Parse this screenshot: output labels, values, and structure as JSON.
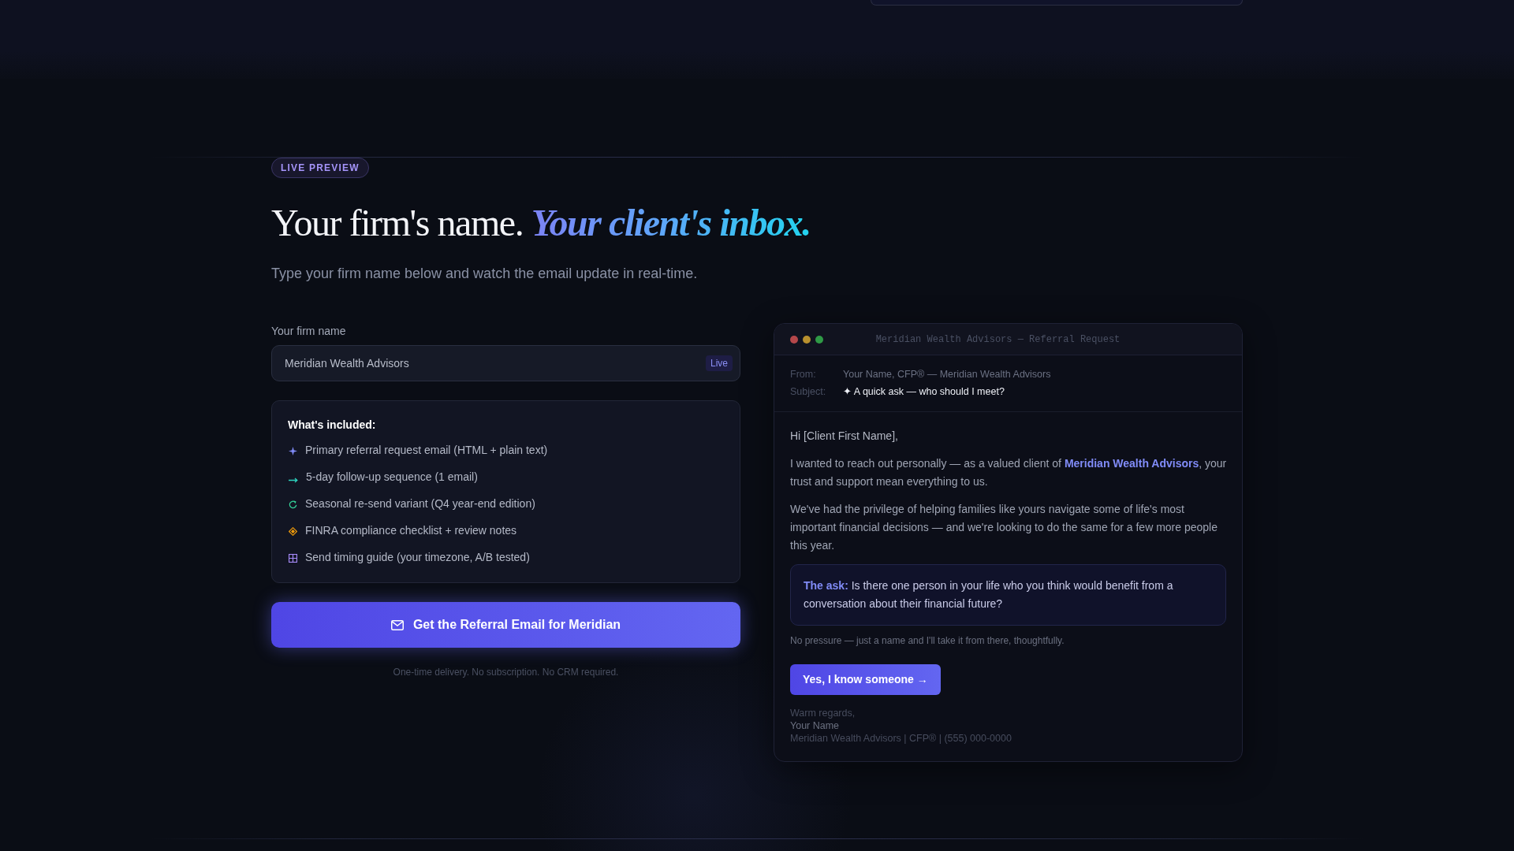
{
  "section": {
    "label": "LIVE PREVIEW",
    "heading": "Your firm's name. *Your client's inbox.*",
    "subtitle": "Type your firm name below and watch the email update in real-time."
  },
  "form": {
    "label": "Your firm name",
    "input": {
      "value": "Meridian Wealth Advisors",
      "tag": "Live"
    }
  },
  "included": {
    "title": "What's included:",
    "items": [
      {
        "kind": "sparkle",
        "text": "Primary referral request email (HTML + plain text)"
      },
      {
        "kind": "arrow",
        "text": "5-day follow-up sequence (1 email)"
      },
      {
        "kind": "refresh",
        "text": "Seasonal re-send variant (Q4 year-end edition)"
      },
      {
        "kind": "diamond",
        "text": "FINRA compliance checklist + review notes"
      },
      {
        "kind": "grid",
        "text": "Send timing guide (your timezone, A/B tested)"
      }
    ]
  },
  "cta": {
    "label": "Get the Referral Email for Meridian",
    "note": "One-time delivery. No subscription. No CRM required."
  },
  "email_preview": {
    "window_title": "Meridian Wealth Advisors — Referral Request",
    "fields": [
      {
        "kind": "sender",
        "label": "From:",
        "value": "Your Name, CFP® — Meridian Wealth Advisors"
      },
      {
        "kind": "subject",
        "label": "Subject:",
        "value": "✦ A quick ask — who should I meet?"
      }
    ],
    "greeting": "Hi [Client First Name],",
    "paragraphs": [
      "I wanted to reach out personally — as a valued client of **Meridian Wealth Advisors**, your trust and support mean everything to us.",
      "We've had the privilege of helping families like yours navigate some of life's most important financial decisions — and we're looking to do the same for a few more people this year."
    ],
    "ask": "**The ask:** Is there one person in your life who you think would benefit from a conversation about their financial future?",
    "note": "No pressure — just a name and I'll take it from there, thoughtfully.",
    "button": "Yes, I know someone →",
    "signature": [
      {
        "kind": "closing",
        "text": "Warm regards,"
      },
      {
        "kind": "name",
        "text": "Your Name"
      },
      {
        "kind": "details",
        "text": "Meridian Wealth Advisors | CFP® | (555) 000-0000"
      }
    ]
  }
}
